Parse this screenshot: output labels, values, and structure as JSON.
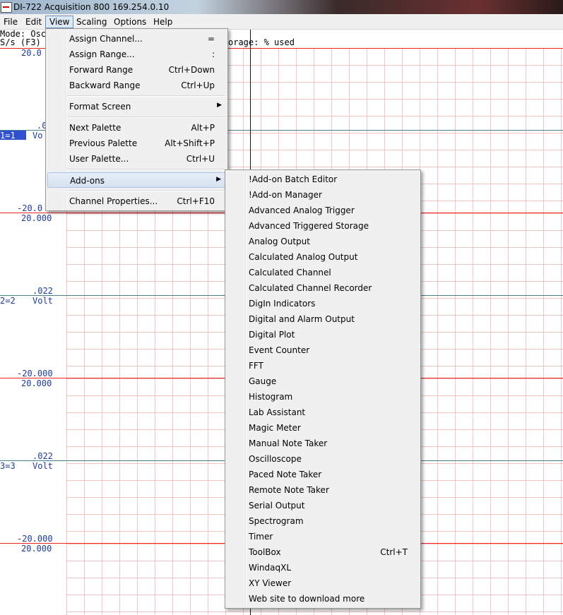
{
  "window": {
    "title": "DI-722 Acquisition 800 169.254.0.10"
  },
  "menubar": {
    "items": [
      "File",
      "Edit",
      "View",
      "Scaling",
      "Options",
      "Help"
    ]
  },
  "status": {
    "mode": "Mode: Osc",
    "rate": "S/s (F3)",
    "storage": "orage:     % used"
  },
  "channels": [
    {
      "top": "20.0",
      "mid_value": ".0",
      "label": "1=1",
      "unit": "Vo",
      "bottom": "-20.0"
    },
    {
      "top": "20.000",
      "mid_value": ".022",
      "label": "2=2",
      "unit": "Volt",
      "bottom": "-20.000"
    },
    {
      "top": "20.000",
      "mid_value": ".022",
      "label": "3=3",
      "unit": "Volt",
      "bottom": "-20.000"
    },
    {
      "top": "20.000"
    }
  ],
  "view_menu": [
    {
      "label": "Assign Channel...",
      "shortcut": "="
    },
    {
      "label": "Assign Range...",
      "shortcut": ":"
    },
    {
      "label": "Forward Range",
      "shortcut": "Ctrl+Down"
    },
    {
      "label": "Backward Range",
      "shortcut": "Ctrl+Up"
    },
    {
      "label": "Format Screen",
      "shortcut": ""
    },
    {
      "label": "Next Palette",
      "shortcut": "Alt+P"
    },
    {
      "label": "Previous Palette",
      "shortcut": "Alt+Shift+P"
    },
    {
      "label": "User Palette...",
      "shortcut": "Ctrl+U"
    },
    {
      "label": "Add-ons",
      "shortcut": ""
    },
    {
      "label": "Channel Properties...",
      "shortcut": "Ctrl+F10"
    }
  ],
  "addons_menu": [
    {
      "label": "!Add-on Batch Editor",
      "shortcut": ""
    },
    {
      "label": "!Add-on Manager",
      "shortcut": ""
    },
    {
      "label": "Advanced Analog Trigger",
      "shortcut": ""
    },
    {
      "label": "Advanced Triggered Storage",
      "shortcut": ""
    },
    {
      "label": "Analog Output",
      "shortcut": ""
    },
    {
      "label": "Calculated Analog Output",
      "shortcut": ""
    },
    {
      "label": "Calculated Channel",
      "shortcut": ""
    },
    {
      "label": "Calculated Channel Recorder",
      "shortcut": ""
    },
    {
      "label": "DigIn Indicators",
      "shortcut": ""
    },
    {
      "label": "Digital and Alarm Output",
      "shortcut": ""
    },
    {
      "label": "Digital Plot",
      "shortcut": ""
    },
    {
      "label": "Event Counter",
      "shortcut": ""
    },
    {
      "label": "FFT",
      "shortcut": ""
    },
    {
      "label": "Gauge",
      "shortcut": ""
    },
    {
      "label": "Histogram",
      "shortcut": ""
    },
    {
      "label": "Lab Assistant",
      "shortcut": ""
    },
    {
      "label": "Magic Meter",
      "shortcut": ""
    },
    {
      "label": "Manual Note Taker",
      "shortcut": ""
    },
    {
      "label": "Oscilloscope",
      "shortcut": ""
    },
    {
      "label": "Paced Note Taker",
      "shortcut": ""
    },
    {
      "label": "Remote Note Taker",
      "shortcut": ""
    },
    {
      "label": "Serial Output",
      "shortcut": ""
    },
    {
      "label": "Spectrogram",
      "shortcut": ""
    },
    {
      "label": "Timer",
      "shortcut": ""
    },
    {
      "label": "ToolBox",
      "shortcut": "Ctrl+T"
    },
    {
      "label": "WindaqXL",
      "shortcut": ""
    },
    {
      "label": "XY Viewer",
      "shortcut": ""
    },
    {
      "label": "Web site to download more",
      "shortcut": ""
    }
  ],
  "colors": {
    "gridline": "#e22222",
    "trace": "#4a7f8f",
    "highlight": "#3050d0"
  }
}
